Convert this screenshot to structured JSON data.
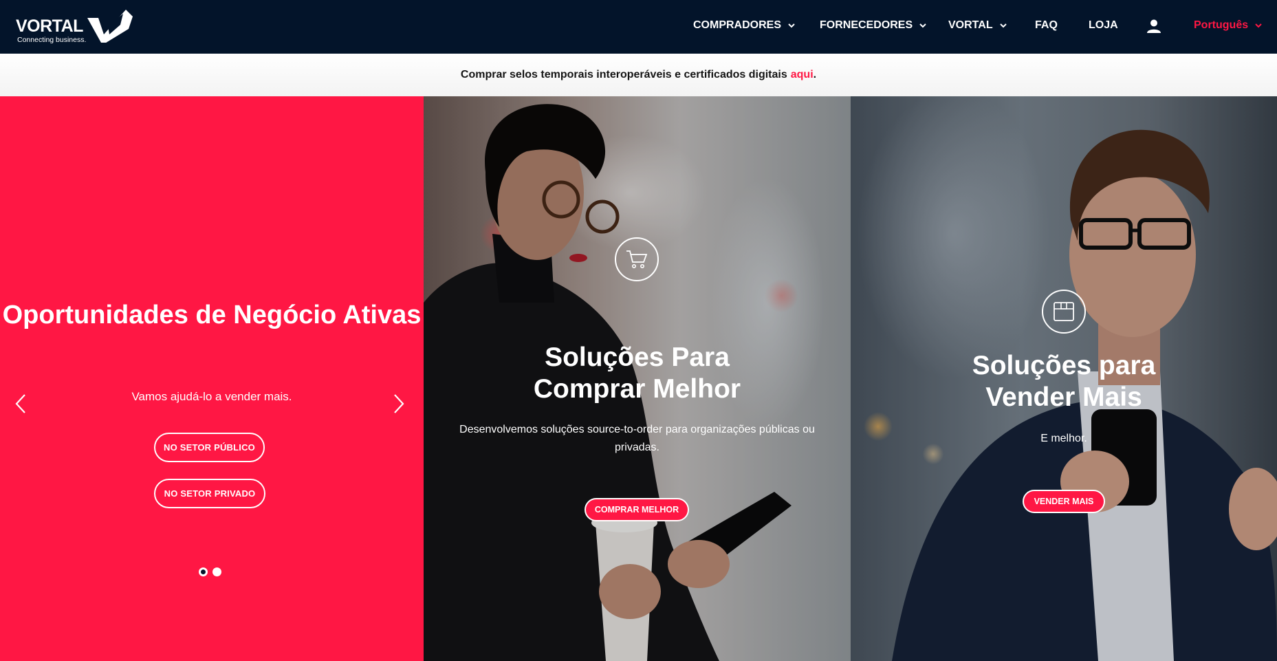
{
  "header": {
    "logo_text": "VORTAL",
    "logo_tagline": "Connecting business.",
    "nav": [
      {
        "label": "COMPRADORES",
        "has_dropdown": true
      },
      {
        "label": "FORNECEDORES",
        "has_dropdown": true
      },
      {
        "label": "VORTAL",
        "has_dropdown": true
      },
      {
        "label": "FAQ",
        "has_dropdown": false
      },
      {
        "label": "LOJA",
        "has_dropdown": false
      }
    ],
    "account_icon": "user-icon",
    "language": "Português"
  },
  "notice": {
    "text": "Comprar selos temporais interoperáveis e certificados digitais",
    "link_label": "aqui",
    "suffix": "."
  },
  "carousel": {
    "title": "Oportunidades de Negócio Ativas",
    "subtitle": "Vamos ajudá-lo a vender mais.",
    "buttons": [
      "NO SETOR PÚBLICO",
      "NO SETOR PRIVADO"
    ],
    "slide_count": 2,
    "active_slide": 1
  },
  "buy_card": {
    "icon": "cart-icon",
    "title_line1": "Soluções Para",
    "title_line2": "Comprar Melhor",
    "text": "Desenvolvemos soluções source-to-order para organizações públicas ou privadas.",
    "cta": "COMPRAR MELHOR"
  },
  "sell_card": {
    "icon": "box-icon",
    "title_line1": "Soluções para",
    "title_line2": "Vender Mais",
    "text": "E melhor.",
    "cta": "VENDER MAIS"
  },
  "colors": {
    "nav_bg": "#03142a",
    "accent": "#ff1744",
    "text_light": "#ffffff"
  }
}
